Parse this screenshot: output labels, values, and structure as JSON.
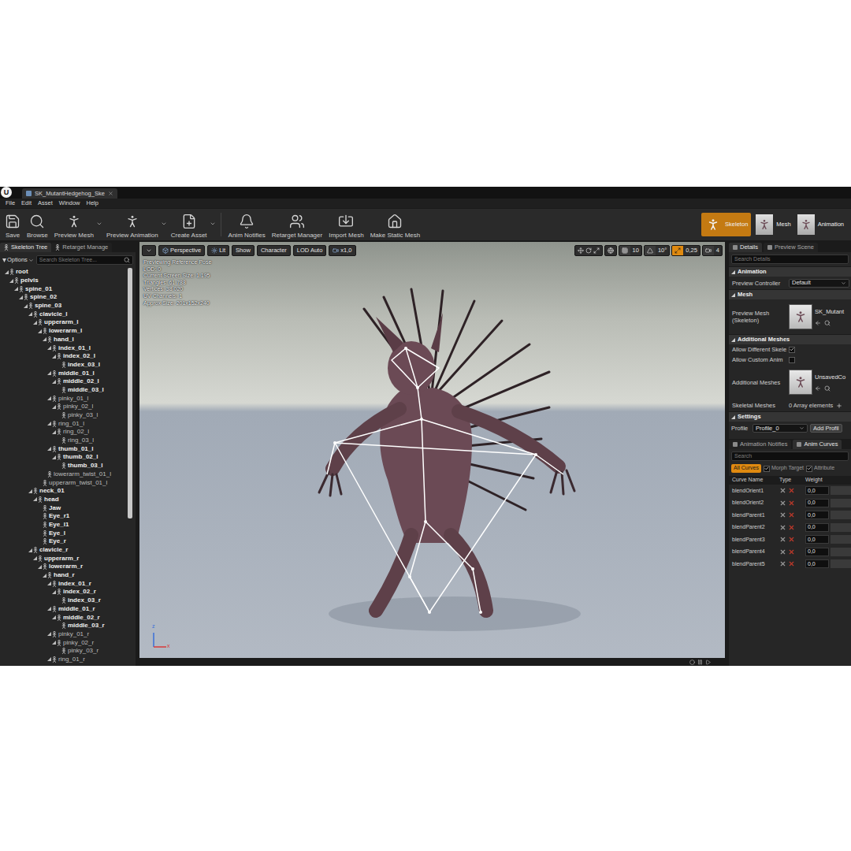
{
  "window": {
    "logo": "U",
    "tab": "SK_MutantHedgehog_Ske"
  },
  "menu": [
    "File",
    "Edit",
    "Asset",
    "Window",
    "Help"
  ],
  "toolbar": {
    "asset_actions": [
      {
        "label": "Save",
        "dropdown": false
      },
      {
        "label": "Browse",
        "dropdown": false
      },
      {
        "label": "Preview Mesh",
        "dropdown": true
      },
      {
        "label": "Preview Animation",
        "dropdown": true
      },
      {
        "label": "Create Asset",
        "dropdown": true
      }
    ],
    "skeleton_actions": [
      {
        "label": "Anim Notifies",
        "dropdown": false
      },
      {
        "label": "Retarget Manager",
        "dropdown": false
      },
      {
        "label": "Import Mesh",
        "dropdown": false
      },
      {
        "label": "Make Static Mesh",
        "dropdown": false
      }
    ]
  },
  "modes": [
    {
      "label": "Skeleton",
      "selected": true
    },
    {
      "label": "Mesh",
      "selected": false
    },
    {
      "label": "Animation",
      "selected": false
    }
  ],
  "skeleton_tree": {
    "tabs": [
      {
        "label": "Skeleton Tree",
        "selected": true
      },
      {
        "label": "Retarget Manage",
        "selected": false
      }
    ],
    "options": "Options",
    "search": {
      "placeholder": "Search Skeleton Tree..."
    },
    "scroll": {
      "level": 0.63
    },
    "bones": [
      {
        "name": "root",
        "depth": 0,
        "expanded": true,
        "weighted": true
      },
      {
        "name": "pelvis",
        "depth": 1,
        "expanded": true,
        "weighted": true
      },
      {
        "name": "spine_01",
        "depth": 2,
        "expanded": true,
        "weighted": true
      },
      {
        "name": "spine_02",
        "depth": 3,
        "expanded": true,
        "weighted": true
      },
      {
        "name": "spine_03",
        "depth": 4,
        "expanded": true,
        "weighted": true
      },
      {
        "name": "clavicle_l",
        "depth": 5,
        "expanded": true,
        "weighted": true
      },
      {
        "name": "upperarm_l",
        "depth": 6,
        "expanded": true,
        "weighted": true
      },
      {
        "name": "lowerarm_l",
        "depth": 7,
        "expanded": true,
        "weighted": true
      },
      {
        "name": "hand_l",
        "depth": 8,
        "expanded": true,
        "weighted": true
      },
      {
        "name": "index_01_l",
        "depth": 9,
        "expanded": true,
        "weighted": true
      },
      {
        "name": "index_02_l",
        "depth": 10,
        "expanded": true,
        "weighted": true
      },
      {
        "name": "index_03_l",
        "depth": 11,
        "expanded": false,
        "weighted": true
      },
      {
        "name": "middle_01_l",
        "depth": 9,
        "expanded": true,
        "weighted": true
      },
      {
        "name": "middle_02_l",
        "depth": 10,
        "expanded": true,
        "weighted": true
      },
      {
        "name": "middle_03_l",
        "depth": 11,
        "expanded": false,
        "weighted": true
      },
      {
        "name": "pinky_01_l",
        "depth": 9,
        "expanded": true,
        "weighted": false
      },
      {
        "name": "pinky_02_l",
        "depth": 10,
        "expanded": true,
        "weighted": false
      },
      {
        "name": "pinky_03_l",
        "depth": 11,
        "expanded": false,
        "weighted": false
      },
      {
        "name": "ring_01_l",
        "depth": 9,
        "expanded": true,
        "weighted": false
      },
      {
        "name": "ring_02_l",
        "depth": 10,
        "expanded": true,
        "weighted": false
      },
      {
        "name": "ring_03_l",
        "depth": 11,
        "expanded": false,
        "weighted": false
      },
      {
        "name": "thumb_01_l",
        "depth": 9,
        "expanded": true,
        "weighted": true
      },
      {
        "name": "thumb_02_l",
        "depth": 10,
        "expanded": true,
        "weighted": true
      },
      {
        "name": "thumb_03_l",
        "depth": 11,
        "expanded": false,
        "weighted": true
      },
      {
        "name": "lowerarm_twist_01_l",
        "depth": 8,
        "expanded": false,
        "weighted": false
      },
      {
        "name": "upperarm_twist_01_l",
        "depth": 7,
        "expanded": false,
        "weighted": false
      },
      {
        "name": "neck_01",
        "depth": 5,
        "expanded": true,
        "weighted": true
      },
      {
        "name": "head",
        "depth": 6,
        "expanded": true,
        "weighted": true
      },
      {
        "name": "Jaw",
        "depth": 7,
        "expanded": false,
        "weighted": true
      },
      {
        "name": "Eye_r1",
        "depth": 7,
        "expanded": false,
        "weighted": true
      },
      {
        "name": "Eye_l1",
        "depth": 7,
        "expanded": false,
        "weighted": true
      },
      {
        "name": "Eye_l",
        "depth": 7,
        "expanded": false,
        "weighted": true
      },
      {
        "name": "Eye_r",
        "depth": 7,
        "expanded": false,
        "weighted": true
      },
      {
        "name": "clavicle_r",
        "depth": 5,
        "expanded": true,
        "weighted": true
      },
      {
        "name": "upperarm_r",
        "depth": 6,
        "expanded": true,
        "weighted": true
      },
      {
        "name": "lowerarm_r",
        "depth": 7,
        "expanded": true,
        "weighted": true
      },
      {
        "name": "hand_r",
        "depth": 8,
        "expanded": true,
        "weighted": true
      },
      {
        "name": "index_01_r",
        "depth": 9,
        "expanded": true,
        "weighted": true
      },
      {
        "name": "index_02_r",
        "depth": 10,
        "expanded": true,
        "weighted": true
      },
      {
        "name": "index_03_r",
        "depth": 11,
        "expanded": false,
        "weighted": true
      },
      {
        "name": "middle_01_r",
        "depth": 9,
        "expanded": true,
        "weighted": true
      },
      {
        "name": "middle_02_r",
        "depth": 10,
        "expanded": true,
        "weighted": true
      },
      {
        "name": "middle_03_r",
        "depth": 11,
        "expanded": false,
        "weighted": true
      },
      {
        "name": "pinky_01_r",
        "depth": 9,
        "expanded": true,
        "weighted": false
      },
      {
        "name": "pinky_02_r",
        "depth": 10,
        "expanded": true,
        "weighted": false
      },
      {
        "name": "pinky_03_r",
        "depth": 11,
        "expanded": false,
        "weighted": false
      },
      {
        "name": "ring_01_r",
        "depth": 9,
        "expanded": true,
        "weighted": false
      }
    ]
  },
  "viewport": {
    "buttons": [
      "Perspective",
      "Lit",
      "Show",
      "Character",
      "LOD Auto",
      "x1,0"
    ],
    "snaps": [
      {
        "value": "10",
        "active": false
      },
      {
        "value": "10°",
        "active": false
      },
      {
        "value": "0,25",
        "active": true
      },
      {
        "value": "4",
        "active": false
      }
    ],
    "stats": [
      "Previewing Reference Pose",
      "LOD: 0",
      "Current Screen Size: 1,195",
      "Triangles: 61 788",
      "Vertices: 38 020",
      "UV Channels: 1",
      "Approx Size: 201x152x240"
    ],
    "axes": {
      "z": "z",
      "x": "x"
    }
  },
  "details": {
    "tabs": [
      {
        "label": "Details",
        "selected": true
      },
      {
        "label": "Preview Scene",
        "selected": false
      }
    ],
    "search": {
      "placeholder": "Search Details"
    },
    "sections": [
      {
        "title": "Animation",
        "rows": [
          {
            "kind": "dropdown",
            "label": "Preview Controller",
            "value": "Default"
          }
        ]
      },
      {
        "title": "Mesh",
        "rows": [
          {
            "kind": "asset",
            "label": "Preview Mesh (Skeleton)",
            "value": "SK_Mutant"
          }
        ]
      },
      {
        "title": "Additional Meshes",
        "rows": [
          {
            "kind": "checkbox",
            "label": "Allow Different Skele",
            "checked": true
          },
          {
            "kind": "checkbox",
            "label": "Allow Custom Anim",
            "checked": false
          },
          {
            "kind": "asset",
            "label": "Additional Meshes",
            "value": "UnsavedCo"
          },
          {
            "kind": "array",
            "label": "Skeletal Meshes",
            "value": "0 Array elements"
          }
        ]
      },
      {
        "title": "Settings",
        "rows": [
          {
            "kind": "profile",
            "label": "Profile",
            "value": "Profile_0",
            "button": "Add Profil"
          }
        ]
      }
    ]
  },
  "anim_curves": {
    "tabs": [
      {
        "label": "Animation Notifies",
        "selected": false
      },
      {
        "label": "Anim Curves",
        "selected": true
      }
    ],
    "search": {
      "placeholder": "Search"
    },
    "filters": [
      {
        "label": "All Curves",
        "kind": "button",
        "on": true
      },
      {
        "label": "Morph Target",
        "kind": "checkbox",
        "on": true
      },
      {
        "label": "Attribute",
        "kind": "checkbox",
        "on": true
      }
    ],
    "columns": [
      "Curve Name",
      "Type",
      "Weight"
    ],
    "rows": [
      {
        "name": "blendOrient1",
        "weight": "0,0",
        "level": 0
      },
      {
        "name": "blendOrient2",
        "weight": "0,0",
        "level": 0
      },
      {
        "name": "blendParent1",
        "weight": "0,0",
        "level": 0
      },
      {
        "name": "blendParent2",
        "weight": "0,0",
        "level": 0
      },
      {
        "name": "blendParent3",
        "weight": "0,0",
        "level": 0
      },
      {
        "name": "blendParent4",
        "weight": "0,0",
        "level": 0
      },
      {
        "name": "blendParent5",
        "weight": "0,0",
        "level": 0
      }
    ]
  }
}
